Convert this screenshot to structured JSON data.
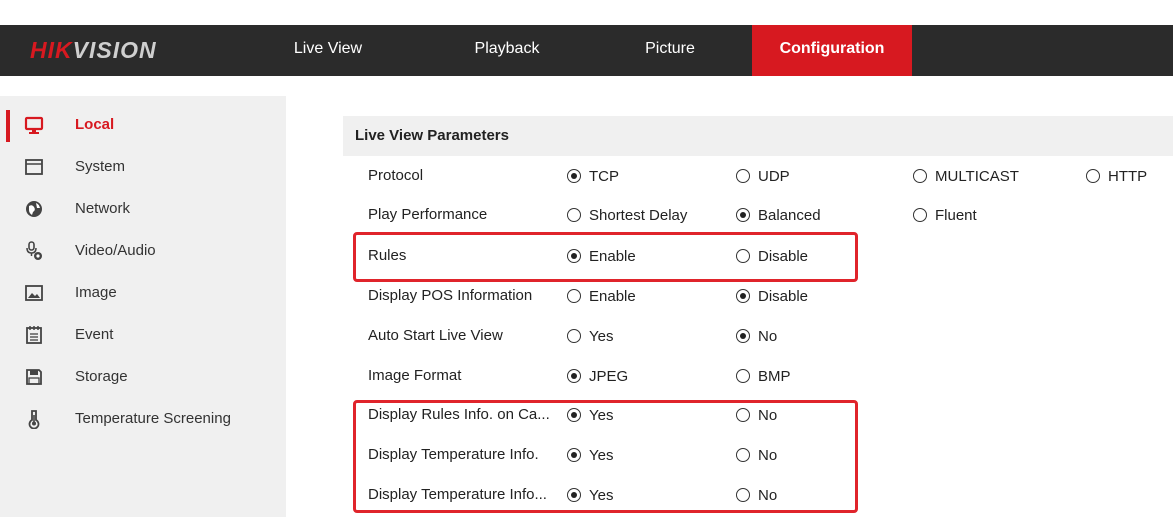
{
  "brand": {
    "logo_red": "HIK",
    "logo_grey": "VISION",
    "accent": "#d71920"
  },
  "nav": {
    "tabs": [
      {
        "label": "Live View",
        "active": false
      },
      {
        "label": "Playback",
        "active": false
      },
      {
        "label": "Picture",
        "active": false
      },
      {
        "label": "Configuration",
        "active": true
      }
    ]
  },
  "sidebar": {
    "items": [
      {
        "label": "Local",
        "icon": "monitor-icon",
        "active": true
      },
      {
        "label": "System",
        "icon": "system-window-icon",
        "active": false
      },
      {
        "label": "Network",
        "icon": "globe-icon",
        "active": false
      },
      {
        "label": "Video/Audio",
        "icon": "microphone-camera-icon",
        "active": false
      },
      {
        "label": "Image",
        "icon": "image-icon",
        "active": false
      },
      {
        "label": "Event",
        "icon": "calendar-icon",
        "active": false
      },
      {
        "label": "Storage",
        "icon": "floppy-disk-icon",
        "active": false
      },
      {
        "label": "Temperature Screening",
        "icon": "thermometer-icon",
        "active": false
      }
    ]
  },
  "main": {
    "section_title": "Live View Parameters",
    "rows": [
      {
        "label": "Protocol",
        "options": [
          {
            "label": "TCP",
            "selected": true
          },
          {
            "label": "UDP",
            "selected": false
          },
          {
            "label": "MULTICAST",
            "selected": false
          },
          {
            "label": "HTTP",
            "selected": false
          }
        ]
      },
      {
        "label": "Play Performance",
        "options": [
          {
            "label": "Shortest Delay",
            "selected": false
          },
          {
            "label": "Balanced",
            "selected": true
          },
          {
            "label": "Fluent",
            "selected": false
          }
        ]
      },
      {
        "label": "Rules",
        "options": [
          {
            "label": "Enable",
            "selected": true
          },
          {
            "label": "Disable",
            "selected": false
          }
        ]
      },
      {
        "label": "Display POS Information",
        "options": [
          {
            "label": "Enable",
            "selected": false
          },
          {
            "label": "Disable",
            "selected": true
          }
        ]
      },
      {
        "label": "Auto Start Live View",
        "options": [
          {
            "label": "Yes",
            "selected": false
          },
          {
            "label": "No",
            "selected": true
          }
        ]
      },
      {
        "label": "Image Format",
        "options": [
          {
            "label": "JPEG",
            "selected": true
          },
          {
            "label": "BMP",
            "selected": false
          }
        ]
      },
      {
        "label": "Display Rules Info. on Ca...",
        "options": [
          {
            "label": "Yes",
            "selected": true
          },
          {
            "label": "No",
            "selected": false
          }
        ]
      },
      {
        "label": "Display Temperature Info.",
        "options": [
          {
            "label": "Yes",
            "selected": true
          },
          {
            "label": "No",
            "selected": false
          }
        ]
      },
      {
        "label": "Display Temperature Info...",
        "options": [
          {
            "label": "Yes",
            "selected": true
          },
          {
            "label": "No",
            "selected": false
          }
        ]
      }
    ]
  },
  "annotation_color": "#e0242b"
}
